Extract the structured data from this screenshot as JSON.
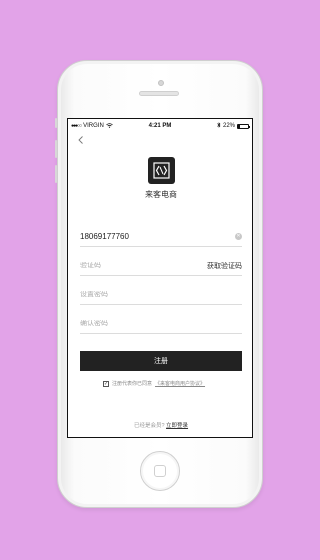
{
  "status_bar": {
    "carrier": "VIRGIN",
    "time": "4:21 PM",
    "battery": "22%",
    "battery_level": 0.22
  },
  "app": {
    "name": "来客电商"
  },
  "form": {
    "phone_value": "18069177760",
    "code_placeholder": "验证码",
    "get_code_label": "获取验证码",
    "password_placeholder": "设置密码",
    "confirm_placeholder": "确认密码",
    "register_label": "注册"
  },
  "agreement": {
    "checked": true,
    "text": "注册代表你已同意",
    "link": "《来客电商用户协议》"
  },
  "footer": {
    "prompt": "已经是会员?",
    "login_link": "立即登录"
  },
  "colors": {
    "background": "#e2a3e8",
    "primary": "#222222"
  }
}
